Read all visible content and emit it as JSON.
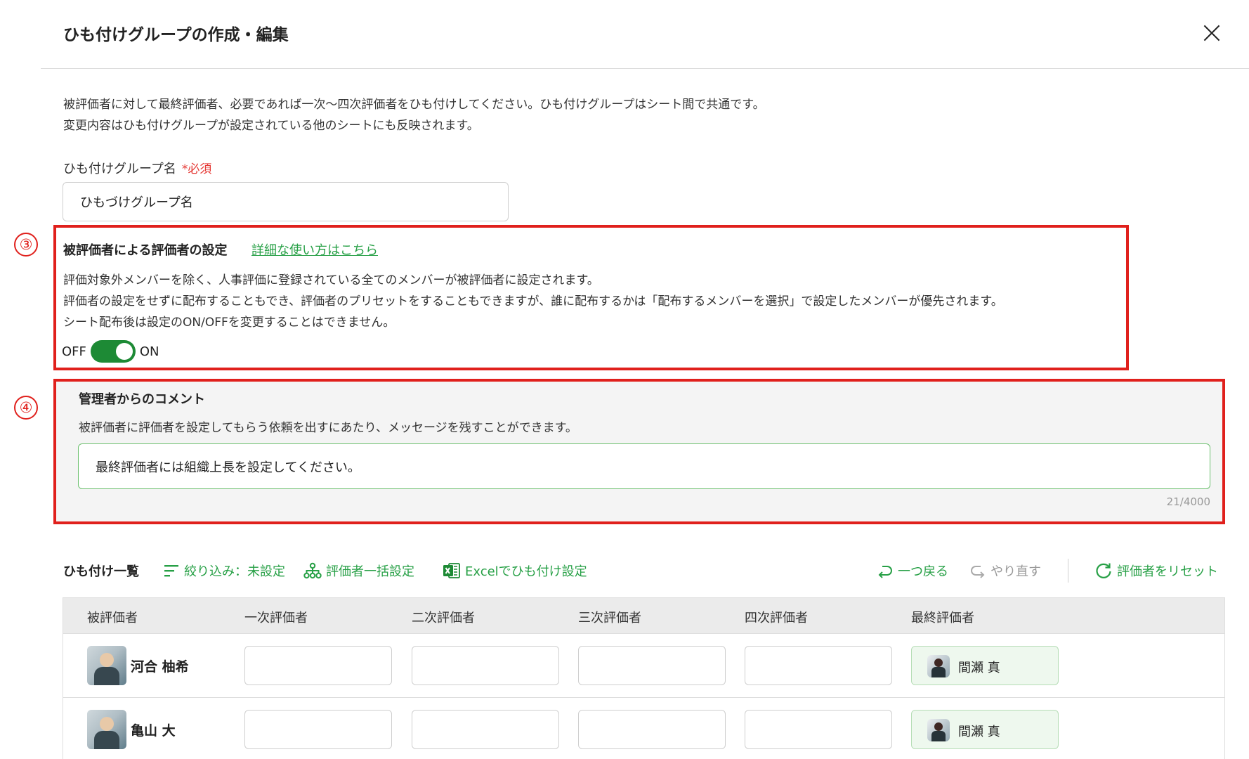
{
  "modal": {
    "title": "ひも付けグループの作成・編集",
    "close_icon": "close-icon"
  },
  "intro": {
    "line1": "被評価者に対して最終評価者、必要であれば一次〜四次評価者をひも付けしてください。ひも付けグループはシート間で共通です。",
    "line2": "変更内容はひも付けグループが設定されている他のシートにも反映されます。"
  },
  "group_name": {
    "label": "ひも付けグループ名",
    "required": "*必須",
    "value": "ひもづけグループ名"
  },
  "markers": {
    "three": "③",
    "four": "④"
  },
  "evaluatee_setting": {
    "title": "被評価者による評価者の設定",
    "link": "詳細な使い方はこちら",
    "desc1": "評価対象外メンバーを除く、人事評価に登録されている全てのメンバーが被評価者に設定されます。",
    "desc2": "評価者の設定をせずに配布することもでき、評価者のプリセットをすることもできますが、誰に配布するかは「配布するメンバーを選択」で設定したメンバーが優先されます。",
    "desc3": "シート配布後は設定のON/OFFを変更することはできません。",
    "off_label": "OFF",
    "on_label": "ON",
    "toggle_state": "on",
    "accent_color": "#1d8a35"
  },
  "admin_comment": {
    "title": "管理者からのコメント",
    "desc": "被評価者に評価者を設定してもらう依頼を出すにあたり、メッセージを残すことができます。",
    "value": "最終評価者には組織上長を設定してください。",
    "count": "21/4000"
  },
  "toolbar": {
    "title": "ひも付け一覧",
    "filter": "絞り込み：未設定",
    "bulk": "評価者一括設定",
    "excel": "Excelでひも付け設定",
    "undo": "一つ戻る",
    "redo": "やり直す",
    "reset": "評価者をリセット",
    "link_color": "#27a046"
  },
  "table": {
    "headers": [
      "被評価者",
      "一次評価者",
      "二次評価者",
      "三次評価者",
      "四次評価者",
      "最終評価者"
    ],
    "rows": [
      {
        "name": "河合 柚希",
        "final": "間瀬 真"
      },
      {
        "name": "亀山 大",
        "final": "間瀬 真"
      }
    ]
  }
}
